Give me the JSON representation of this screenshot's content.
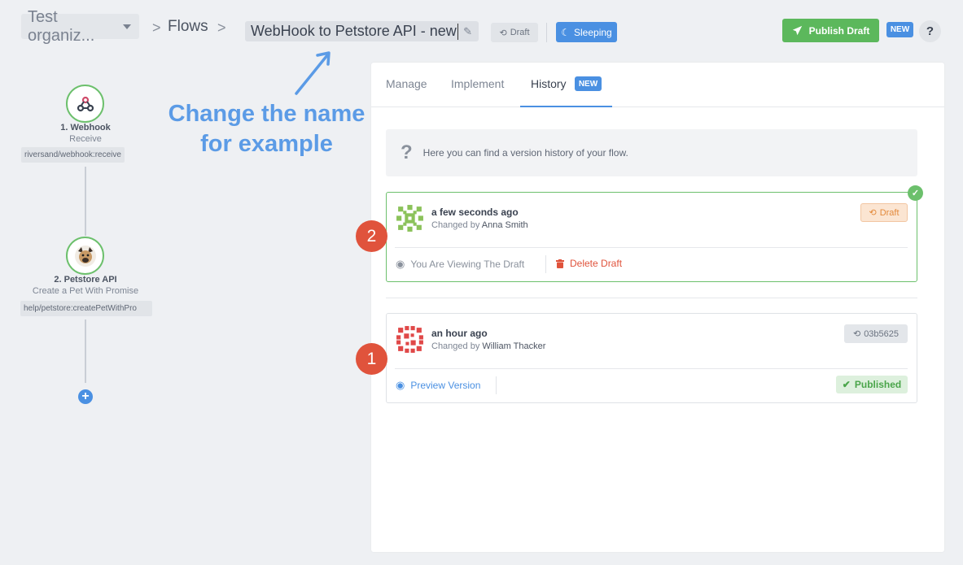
{
  "header": {
    "org_name": "Test organiz...",
    "breadcrumb_sep": ">",
    "flows_label": "Flows",
    "flow_name": "WebHook to Petstore API - new",
    "draft_badge": "Draft",
    "sleeping_badge": "Sleeping",
    "publish_label": "Publish Draft",
    "new_badge": "NEW",
    "help_label": "?"
  },
  "annotation": {
    "line1": "Change the name",
    "line2": "for example",
    "color": "#5b9be6"
  },
  "flow": {
    "steps": [
      {
        "title": "1. Webhook",
        "subtitle": "Receive",
        "path": "riversand/webhook:receive",
        "icon": "webhook-icon"
      },
      {
        "title": "2. Petstore API",
        "subtitle": "Create a Pet With Promise",
        "path": "help/petstore:createPetWithPro",
        "icon": "dog-icon"
      }
    ],
    "add_label": "+"
  },
  "panel": {
    "tabs": {
      "manage": "Manage",
      "implement": "Implement",
      "history": "History",
      "history_badge": "NEW"
    },
    "info": {
      "icon": "?",
      "text": "Here you can find a version history of your flow."
    },
    "versions": [
      {
        "when": "a few seconds ago",
        "changed_by_prefix": "Changed by",
        "author": "Anna Smith",
        "badge": "Draft",
        "action_primary": "You Are Viewing The Draft",
        "action_secondary": "Delete Draft",
        "marker": "2",
        "selected": true
      },
      {
        "when": "an hour ago",
        "changed_by_prefix": "Changed by",
        "author": "William Thacker",
        "badge": "03b5625",
        "action_primary": "Preview Version",
        "status": "Published",
        "marker": "1"
      }
    ]
  },
  "colors": {
    "accent": "#4a90e2",
    "success": "#5cb85c",
    "danger": "#e0533c",
    "warning": "#e38a3c"
  }
}
